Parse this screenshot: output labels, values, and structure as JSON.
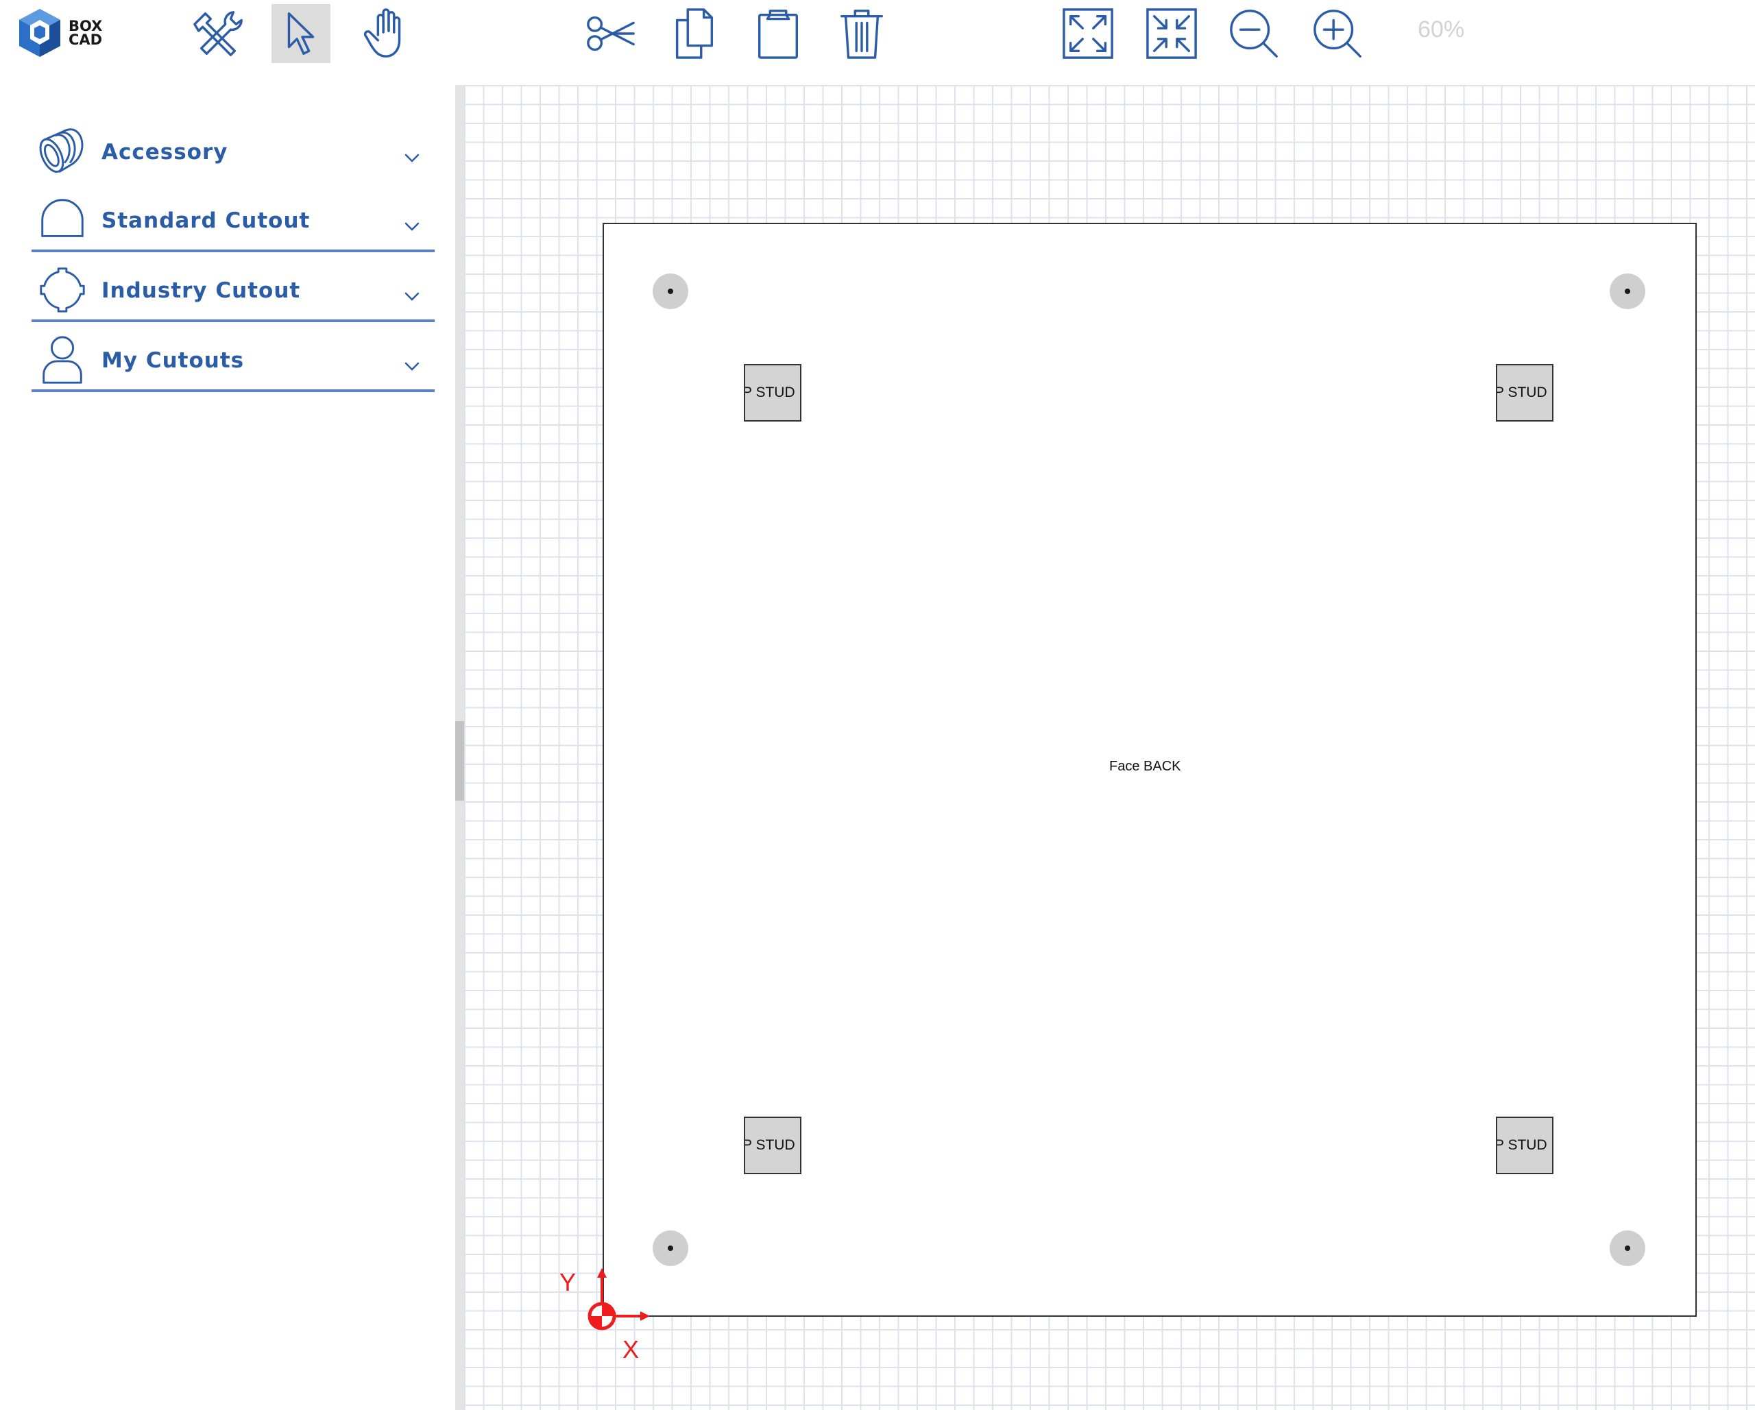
{
  "app": {
    "logo_line1": "BOX",
    "logo_line2": "CAD",
    "logo_icon": "boxcad-cube-logo"
  },
  "toolbar": {
    "tools": [
      {
        "id": "tools",
        "icon": "wrench-screwdriver-icon",
        "label": "Tools"
      },
      {
        "id": "select",
        "icon": "pointer-arrow-icon",
        "label": "Select",
        "active": true
      },
      {
        "id": "pan",
        "icon": "hand-icon",
        "label": "Pan"
      },
      {
        "id": "cut",
        "icon": "scissors-icon",
        "label": "Cut"
      },
      {
        "id": "copy",
        "icon": "copy-icon",
        "label": "Copy"
      },
      {
        "id": "paste",
        "icon": "clipboard-icon",
        "label": "Paste"
      },
      {
        "id": "delete",
        "icon": "trash-icon",
        "label": "Delete"
      },
      {
        "id": "fit",
        "icon": "expand-icon",
        "label": "Fit to screen"
      },
      {
        "id": "shrink",
        "icon": "compress-icon",
        "label": "Shrink"
      },
      {
        "id": "zoom-out",
        "icon": "zoom-out-icon",
        "label": "Zoom out"
      },
      {
        "id": "zoom-in",
        "icon": "zoom-in-icon",
        "label": "Zoom in"
      }
    ],
    "zoom_level": "60%"
  },
  "sidebar": {
    "items": [
      {
        "label": "Accessory",
        "icon": "accessory-icon"
      },
      {
        "label": "Standard Cutout",
        "icon": "standard-cutout-icon"
      },
      {
        "label": "Industry Cutout",
        "icon": "industry-cutout-icon"
      },
      {
        "label": "My Cutouts",
        "icon": "user-icon"
      }
    ]
  },
  "canvas": {
    "face_label": "Face BACK",
    "stud_label": "P STUD",
    "axis_y_label": "Y",
    "axis_x_label": "X"
  },
  "colors": {
    "accent": "#2b5ca8",
    "axis": "#ee1c1c",
    "grid": "#dde3ee"
  }
}
